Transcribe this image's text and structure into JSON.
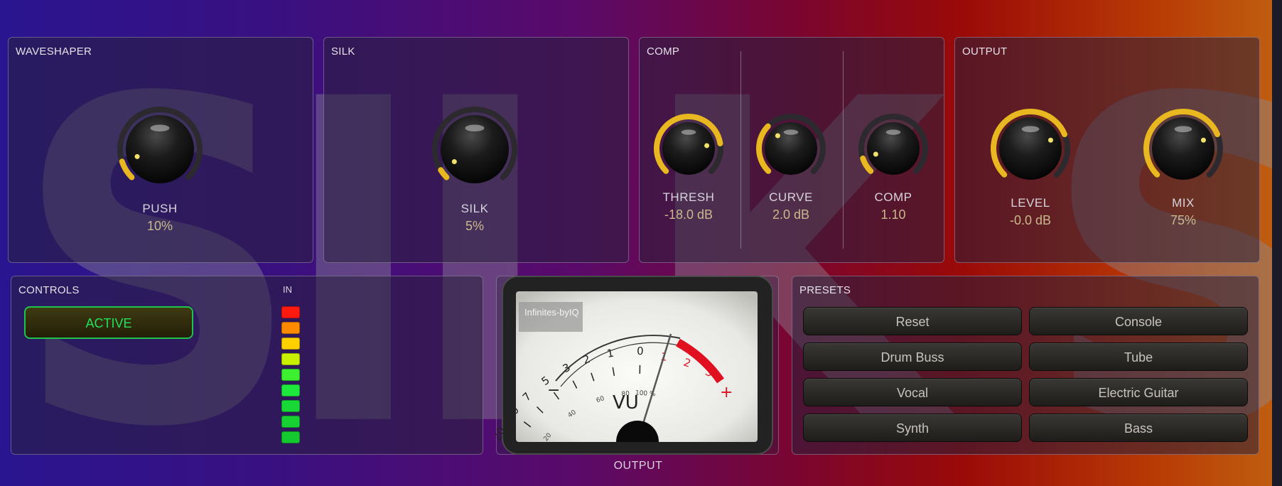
{
  "watermark": "SILK SAND",
  "panels": {
    "waveshaper": {
      "title": "WAVESHAPER",
      "knobs": [
        {
          "label": "PUSH",
          "value": "10%",
          "level": 0.1
        }
      ]
    },
    "silk": {
      "title": "SILK",
      "knobs": [
        {
          "label": "SILK",
          "value": "5%",
          "level": 0.05
        }
      ]
    },
    "comp": {
      "title": "COMP",
      "knobs": [
        {
          "label": "THRESH",
          "value": "-18.0 dB",
          "level": 0.8
        },
        {
          "label": "CURVE",
          "value": "2.0 dB",
          "level": 0.33
        },
        {
          "label": "COMP",
          "value": "1.10",
          "level": 0.1
        }
      ]
    },
    "output": {
      "title": "OUTPUT",
      "knobs": [
        {
          "label": "LEVEL",
          "value": "-0.0 dB",
          "level": 0.75
        },
        {
          "label": "MIX",
          "value": "75%",
          "level": 0.75
        }
      ]
    }
  },
  "controls": {
    "title": "CONTROLS",
    "active_label": "ACTIVE",
    "in_label": "IN",
    "meter_colors": [
      "#ff1a10",
      "#ff8a00",
      "#ffd000",
      "#c8f000",
      "#3cf030",
      "#1ee83c",
      "#18d838",
      "#16d034",
      "#14c830"
    ]
  },
  "vu": {
    "brand": "Infinites‑byIQ",
    "vu_text": "VU",
    "output_label": "OUTPUT",
    "scale_black": [
      "20",
      "10",
      "7",
      "5",
      "3",
      "2",
      "1",
      "0"
    ],
    "scale_red": [
      "1",
      "2",
      "3"
    ],
    "minus": "−",
    "plus": "+",
    "percent_ticks": [
      "20",
      "40",
      "60",
      "80",
      "100 %"
    ]
  },
  "presets": {
    "title": "PRESETS",
    "items": [
      "Reset",
      "Console",
      "Drum Buss",
      "Tube",
      "Vocal",
      "Electric Guitar",
      "Synth",
      "Bass"
    ]
  },
  "colors": {
    "knob_arc": "#e9b820",
    "knob_track": "#2c2a2e",
    "active_green": "#27e05a",
    "vu_red": "#e01020"
  }
}
